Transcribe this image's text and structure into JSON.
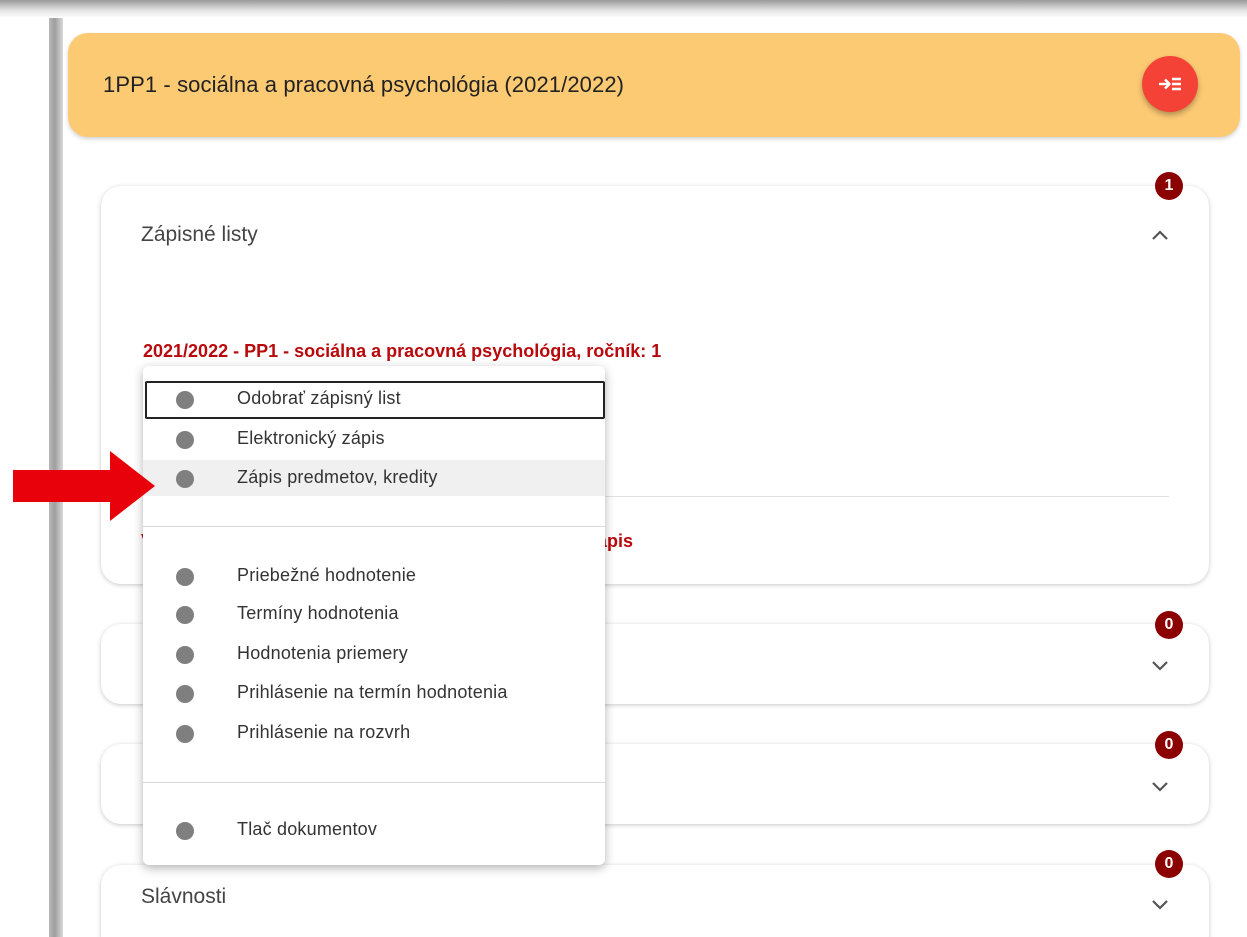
{
  "header": {
    "title": "1PP1 - sociálna a pracovná psychológia (2021/2022)",
    "fab_icon": "collapse-menu-icon"
  },
  "cards": [
    {
      "title": "Zápisné listy",
      "badge": "1",
      "expanded": true
    },
    {
      "title": "",
      "badge": "0",
      "expanded": false
    },
    {
      "title": "",
      "badge": "0",
      "expanded": false
    },
    {
      "title": "Slávnosti",
      "badge": "0",
      "expanded": false
    }
  ],
  "enrollment": {
    "line": "2021/2022 - PP1 - sociálna a pracovná psychológia, ročník: 1",
    "partial_prefix": "V",
    "partial_link": "ápis"
  },
  "menu": {
    "items": [
      {
        "label": "Odobrať zápisný list"
      },
      {
        "label": "Elektronický zápis"
      },
      {
        "label": "Zápis predmetov, kredity"
      },
      {
        "label": "Priebežné hodnotenie"
      },
      {
        "label": "Termíny hodnotenia"
      },
      {
        "label": "Hodnotenia priemery"
      },
      {
        "label": "Prihlásenie na termín hodnotenia"
      },
      {
        "label": "Prihlásenie na rozvrh"
      },
      {
        "label": "Tlač dokumentov"
      }
    ]
  },
  "colors": {
    "header_bg": "#fdca74",
    "fab": "#f44336",
    "accent_red": "#b8090c",
    "badge": "#8b0000",
    "annotation_arrow": "#e8000b"
  }
}
